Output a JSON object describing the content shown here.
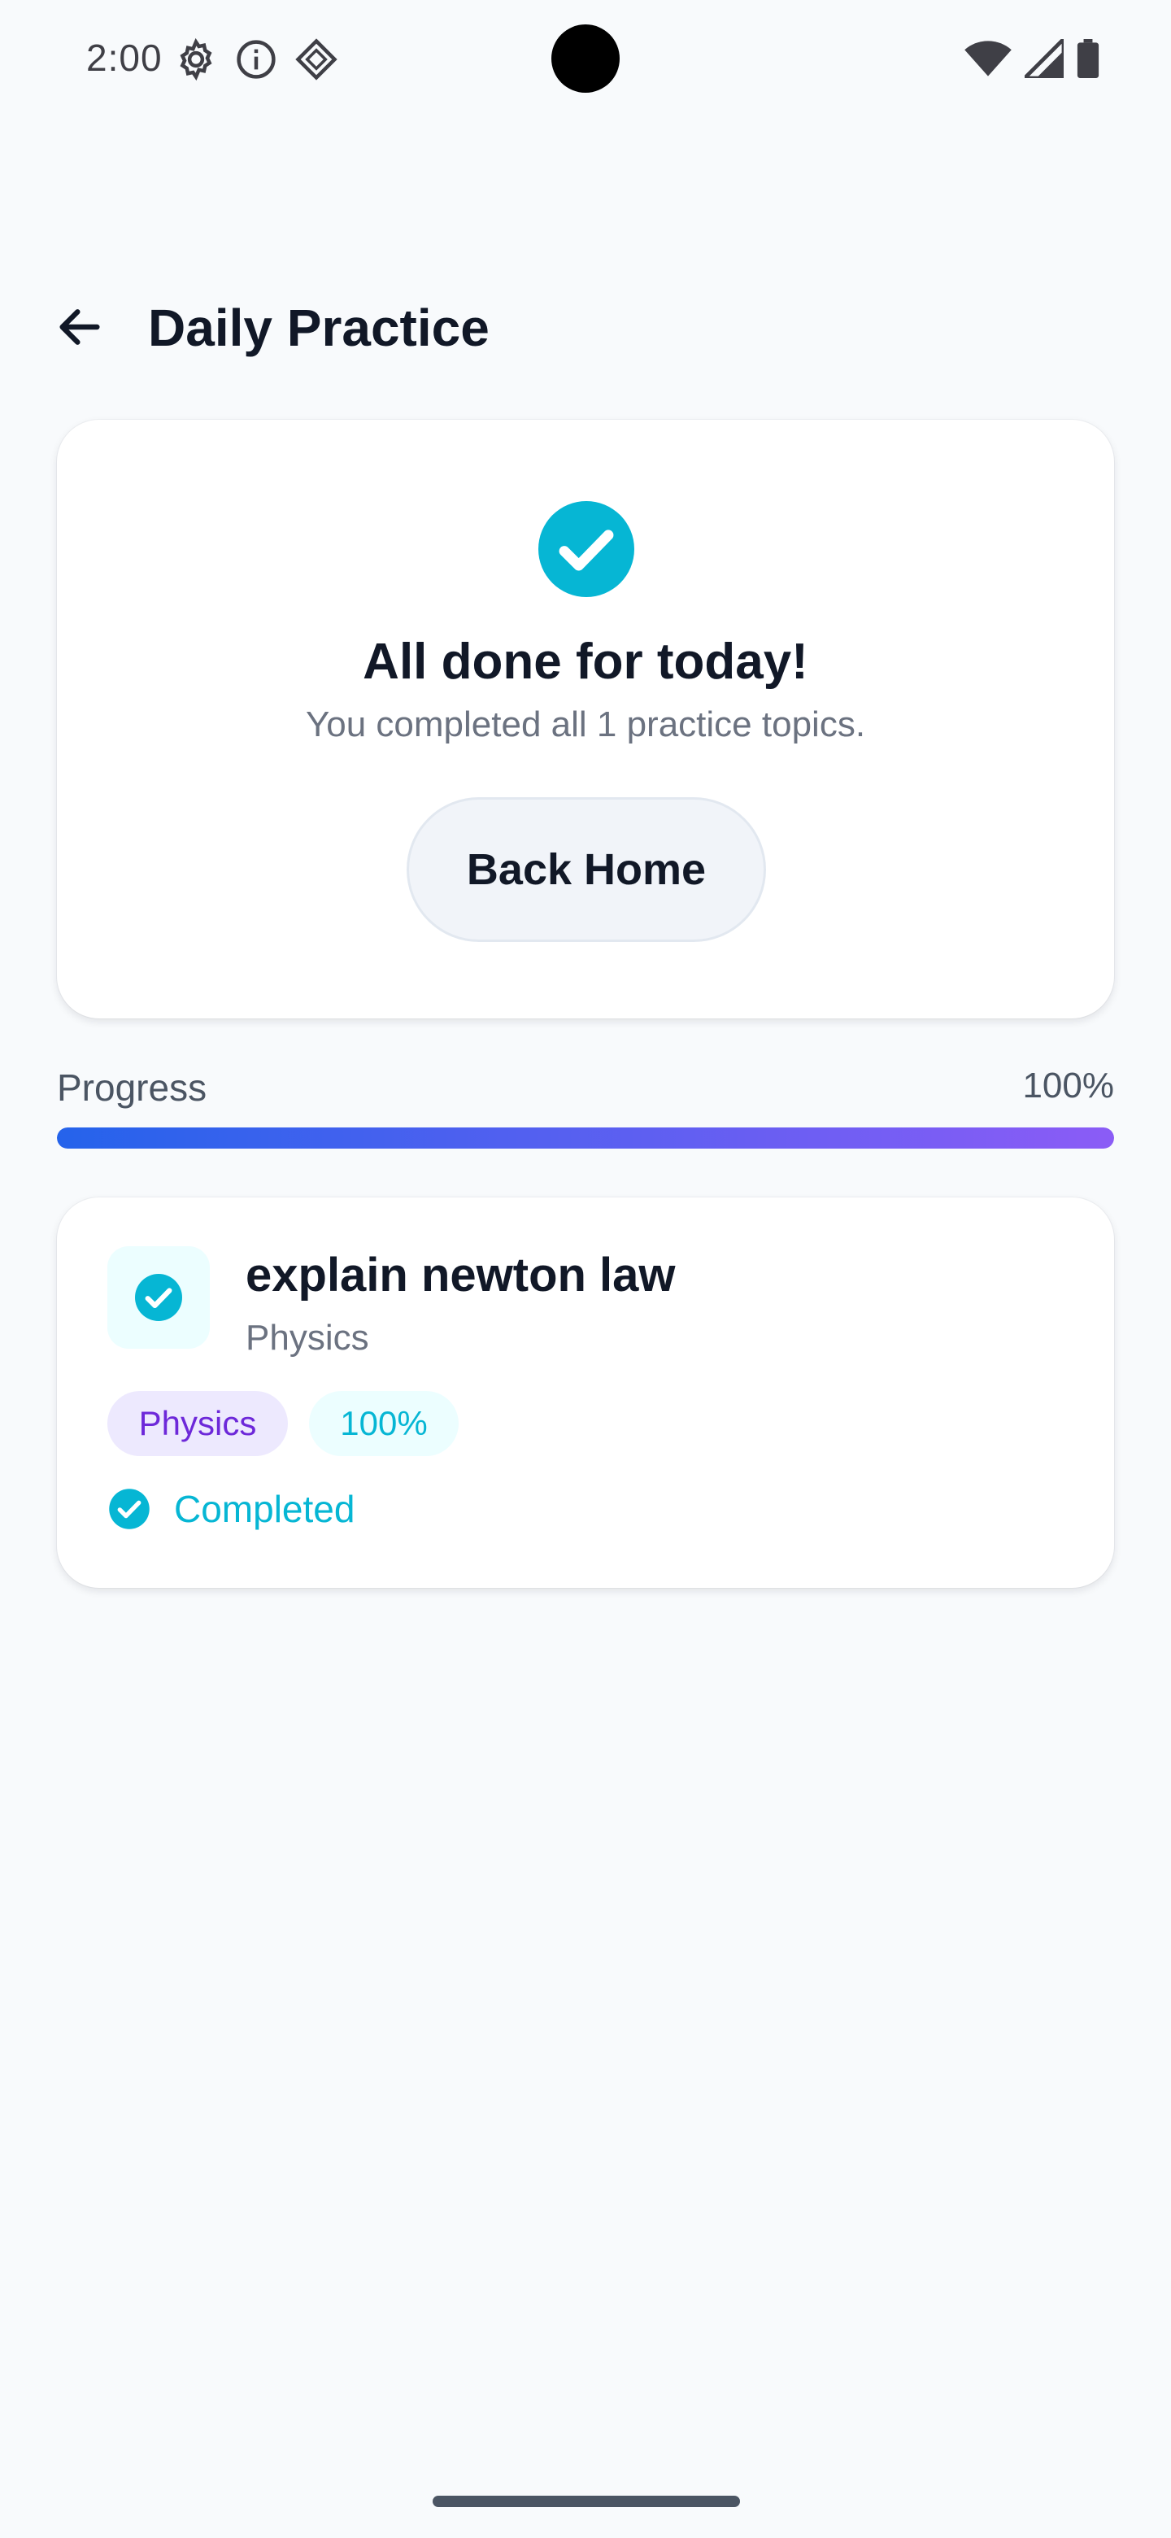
{
  "status_bar": {
    "time": "2:00",
    "left_icons": [
      "gear-icon",
      "info-icon",
      "diamond-icon"
    ],
    "right_icons": [
      "wifi-icon",
      "signal-icon",
      "battery-icon"
    ]
  },
  "header": {
    "title": "Daily Practice",
    "back_icon": "arrow-left-icon"
  },
  "completion_card": {
    "icon": "check-circle-icon",
    "title": "All done for today!",
    "subtitle": "You completed all 1 practice topics.",
    "button_label": "Back Home"
  },
  "progress": {
    "label": "Progress",
    "value_text": "100%",
    "fraction": 1.0
  },
  "topics": [
    {
      "title": "explain newton law",
      "subject": "Physics",
      "chips": {
        "subject": "Physics",
        "percent": "100%"
      },
      "status": "Completed",
      "icon": "check-circle-icon"
    }
  ],
  "colors": {
    "accent_cyan": "#06b6d4",
    "progress_start": "#2563eb",
    "progress_end": "#8b5cf6",
    "chip_subject_bg": "#ede9fe",
    "chip_subject_text": "#6d28d9",
    "background": "#f8fafc"
  }
}
